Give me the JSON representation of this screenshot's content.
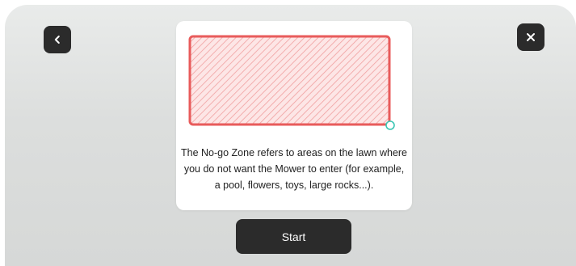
{
  "header": {
    "back_icon": "chevron-left-icon",
    "close_icon": "close-icon"
  },
  "card": {
    "illustration": "no-go-zone-hatched-rectangle",
    "description": "The No-go Zone refers to areas on the lawn where you do not want the Mower to enter (for example, a pool, flowers, toys, large rocks...)."
  },
  "actions": {
    "start_label": "Start"
  },
  "colors": {
    "zone_border": "#e85b5b",
    "zone_hatch": "#f2a8a8",
    "zone_fill": "#fde6e6",
    "handle": "#3cc6b4",
    "button_bg": "#2b2b2b"
  }
}
